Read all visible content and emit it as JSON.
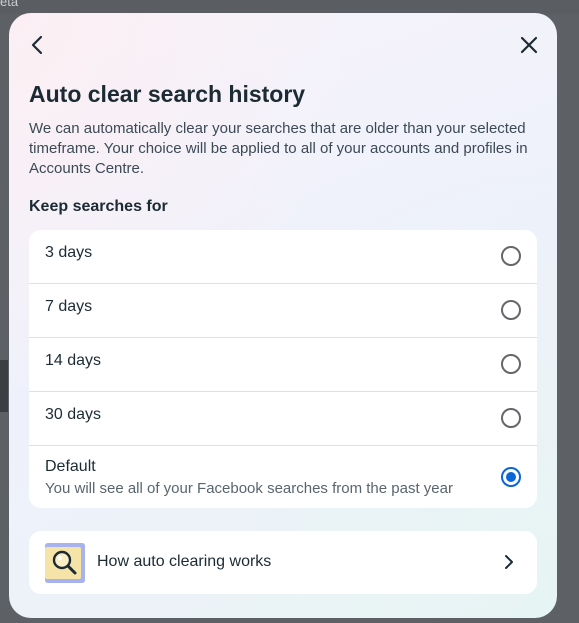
{
  "backdrop": {
    "partial_text": "eta"
  },
  "dialog": {
    "title": "Auto clear search history",
    "description": "We can automatically clear your searches that are older than your selected timeframe. Your choice will be applied to all of your accounts and profiles in Accounts Centre.",
    "keep_label": "Keep searches for",
    "options": [
      {
        "label": "3 days",
        "selected": false
      },
      {
        "label": "7 days",
        "selected": false
      },
      {
        "label": "14 days",
        "selected": false
      },
      {
        "label": "30 days",
        "selected": false
      },
      {
        "label": "Default",
        "sub": "You will see all of your Facebook searches from the past year",
        "selected": true
      }
    ],
    "help_link": {
      "label": "How auto clearing works",
      "icon": "magnifier-illustration"
    }
  },
  "colors": {
    "accent": "#0a66d8",
    "text": "#1c2b33",
    "card": "#ffffff",
    "help_thumb": "#a8b2ec"
  }
}
